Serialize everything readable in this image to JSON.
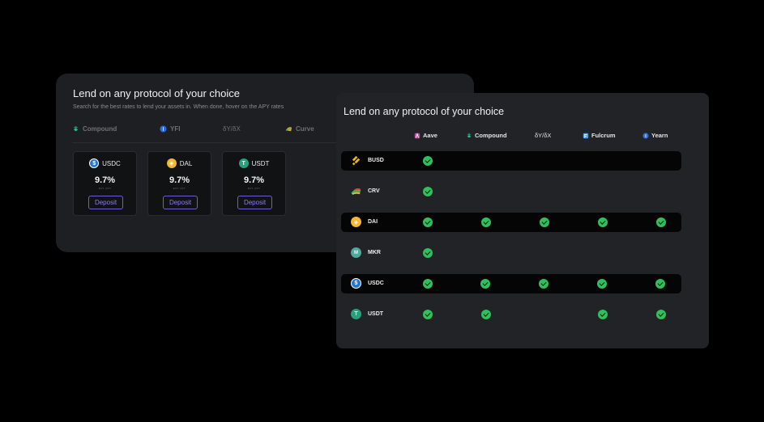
{
  "back_card": {
    "title": "Lend on any protocol of your choice",
    "subtitle": "Search for the best rates to lend your assets in. When done, hover on the APY rates",
    "protocols": [
      {
        "label": "Compound",
        "icon": "compound-icon",
        "color": "#2fbf8f"
      },
      {
        "label": "YFI",
        "icon": "yfi-icon",
        "color": "#2f6cd6"
      },
      {
        "label": "δY/δX",
        "icon": "",
        "color": "#6f7077"
      },
      {
        "label": "Curve",
        "icon": "curve-icon",
        "color": "#d9a93b"
      }
    ],
    "assets": [
      {
        "symbol": "USDC",
        "rate": "9.7%",
        "rate_label": "EST. APY",
        "button": "Deposit",
        "coin_color": "#2775ca"
      },
      {
        "symbol": "DAL",
        "rate": "9.7%",
        "rate_label": "EST. APY",
        "button": "Deposit",
        "coin_color": "#f4b731"
      },
      {
        "symbol": "USDT",
        "rate": "9.7%",
        "rate_label": "EST. APY",
        "button": "Deposit",
        "coin_color": "#26a17b"
      }
    ]
  },
  "front_card": {
    "title": "Lend on any protocol of your choice",
    "columns": [
      {
        "label": "Aave",
        "icon": "aave-icon",
        "color": "#b6509e"
      },
      {
        "label": "Compound",
        "icon": "compound-icon",
        "color": "#2fbf8f"
      },
      {
        "label": "δY/δX",
        "icon": "",
        "color": "#e4e4e7"
      },
      {
        "label": "Fulcrum",
        "icon": "fulcrum-icon",
        "color": "#3ea6ff"
      },
      {
        "label": "Yearn",
        "icon": "yearn-icon",
        "color": "#2f6cd6"
      }
    ],
    "rows": [
      {
        "asset": "BUSD",
        "coin_color": "#f0b90b",
        "checks": [
          true,
          false,
          false,
          false,
          false
        ]
      },
      {
        "asset": "CRV",
        "coin_color": "#e84142",
        "checks": [
          true,
          false,
          false,
          false,
          false
        ]
      },
      {
        "asset": "DAI",
        "coin_color": "#f4b731",
        "checks": [
          true,
          true,
          true,
          true,
          true
        ]
      },
      {
        "asset": "MKR",
        "coin_color": "#4fa89b",
        "checks": [
          true,
          false,
          false,
          false,
          false
        ]
      },
      {
        "asset": "USDC",
        "coin_color": "#2775ca",
        "checks": [
          true,
          true,
          true,
          true,
          true
        ]
      },
      {
        "asset": "USDT",
        "coin_color": "#26a17b",
        "checks": [
          true,
          true,
          false,
          true,
          true
        ]
      }
    ],
    "check_color": "#2fbf5b"
  }
}
